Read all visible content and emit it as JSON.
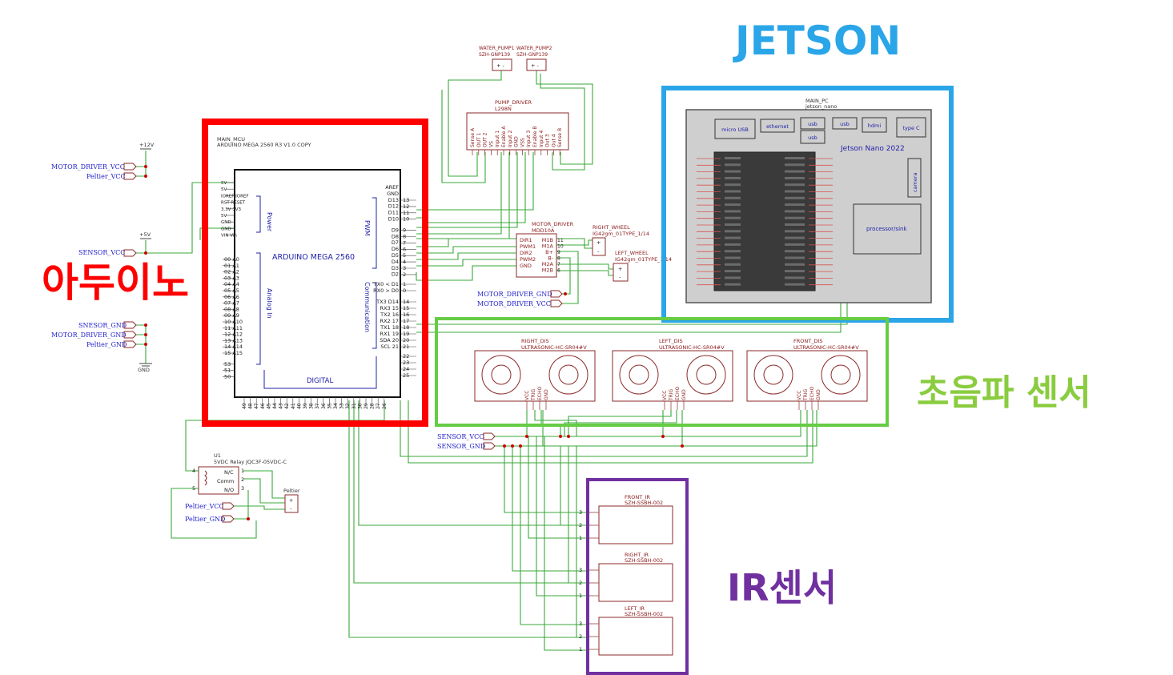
{
  "titles": {
    "jetson": "JETSON",
    "arduino": "아두이노",
    "ultrasonic": "초음파   센서",
    "ir": "IR센서"
  },
  "colors": {
    "jetson_box": "#2aa6e8",
    "arduino_box": "#ff0000",
    "ultrasonic_box": "#66cc44",
    "ir_box": "#7030a0",
    "wire": "#3aa83a",
    "part_outline": "#8b2a2a",
    "net_label": "#2222cc"
  },
  "power": {
    "v12": "+12V",
    "v5": "+5V",
    "gnd": "GND",
    "motor_driver_vcc": "MOTOR_DRIVER_VCC",
    "peltier_vcc": "Peltier_VCC",
    "sensor_vcc": "SENSOR_VCC",
    "snesor_gnd": "SNESOR_GND",
    "motor_driver_gnd": "MOTOR_DRIVER_GND",
    "peltier_gnd": "Peltier_GND"
  },
  "arduino": {
    "ref": "MAIN_MCU",
    "part": "ARDUINO MEGA 2560 R3 V1.0 COPY",
    "title": "ARDUINO MEGA 2560",
    "power_label": "Power",
    "pwm_label": "PWM",
    "analog_label": "Analog In",
    "comm_label": "Communication",
    "digital_label": "DIGITAL",
    "power_pins": [
      "5V",
      "5V",
      "IOREF IOREF",
      "RST RESET",
      "3.3V 3V3",
      "5V",
      "GND",
      "GND",
      "VIN Vin"
    ],
    "analog_pins": [
      "00 A0",
      "01 A1",
      "02 A2",
      "03 A3",
      "04 A4",
      "05 A5",
      "06 A6",
      "07 A7",
      "08 A8",
      "09 A9",
      "10 A10",
      "11 A11",
      "12 A12",
      "13 A13",
      "14 A14",
      "15 A15",
      "53",
      "51",
      "50"
    ],
    "pwm_pins": [
      "AREF",
      "GND",
      "D13",
      "D12",
      "D11",
      "D10",
      "D9",
      "D8",
      "D7",
      "D6",
      "D5",
      "D4",
      "D3",
      "D2"
    ],
    "pwm_nums": [
      "13",
      "12",
      "11",
      "10",
      "9",
      "8",
      "7",
      "6",
      "5",
      "4",
      "3",
      "2"
    ],
    "comm_pins": [
      "TX0 < D1",
      "RX0 > D0",
      "TX3 D14",
      "RX3 15",
      "TX2 16",
      "RX2 17",
      "TX1 18",
      "RX1 19",
      "SDA 20",
      "SCL 21"
    ],
    "right_nums": [
      "1",
      "0",
      "14",
      "15",
      "16",
      "17",
      "18",
      "19",
      "20",
      "21",
      "22",
      "23",
      "24",
      "25"
    ],
    "bottom_pins": [
      "49",
      "48",
      "47",
      "46",
      "45",
      "44",
      "43",
      "42",
      "41",
      "40",
      "39",
      "38",
      "37",
      "36",
      "35",
      "34",
      "33",
      "32",
      "31",
      "30",
      "29",
      "28",
      "27",
      "26"
    ]
  },
  "pump": {
    "pump1_ref": "WATER_PUMP1",
    "pump1_part": "SZH-GNP139",
    "pump2_ref": "WATER_PUMP2",
    "pump2_part": "SZH-GNP139",
    "driver_ref": "PUMP_DRIVER",
    "driver_part": "L298N",
    "driver_pins": [
      "Sense A",
      "OUT 1",
      "OUT 2",
      "VS",
      "Input 1",
      "Enable A",
      "Input 2",
      "GND",
      "VSS",
      "Input 3",
      "Enable B",
      "Input 4",
      "Out 3",
      "Out 4",
      "Sense B"
    ]
  },
  "motor": {
    "driver_ref": "MOTOR_DRIVER",
    "driver_part": "MDD10A",
    "left_pins": [
      "DIR1",
      "PWM1",
      "DIR2",
      "PWM2",
      "GND"
    ],
    "right_pins": [
      "M1B",
      "M1A",
      "B+",
      "B-",
      "M2A",
      "M2B"
    ],
    "right_nums": [
      "11",
      "10",
      "9",
      "8",
      "7",
      "6"
    ],
    "right_wheel_ref": "RIGHT_WHEEL",
    "right_wheel_part": "IG42gm_01TYPE_1/14",
    "left_wheel_ref": "LEFT_WHEEL",
    "left_wheel_part": "IG42gm_01TYPE_1/14"
  },
  "jetson": {
    "ref": "MAIN_PC",
    "part": "jetson_nano",
    "ports": [
      "micro USB",
      "ethernet",
      "usb",
      "usb",
      "usb",
      "hdmi",
      "type C"
    ],
    "board_name": "Jetson Nano 2022",
    "camera": "camera",
    "processor": "processor/sink"
  },
  "ultrasonic": {
    "right_ref": "RIGHT_DIS",
    "left_ref": "LEFT_DIS",
    "front_ref": "FRONT_DIS",
    "part": "ULTRASONIC-HC-SR04#V",
    "pins": [
      "VCC",
      "TRIG",
      "ECHO",
      "GND"
    ]
  },
  "relay": {
    "ref": "U1",
    "part": "5VDC Relay JQC3F-05VDC-C",
    "pins": [
      "N/C",
      "Comm",
      "N/O"
    ],
    "peltier": "Peltier"
  },
  "ir": {
    "front_ref": "FRONT_IR",
    "right_ref": "RIGHT_IR",
    "left_ref": "LEFT_IR",
    "part": "SZH-SSBH-002",
    "pins": [
      "3",
      "2",
      "1"
    ]
  }
}
